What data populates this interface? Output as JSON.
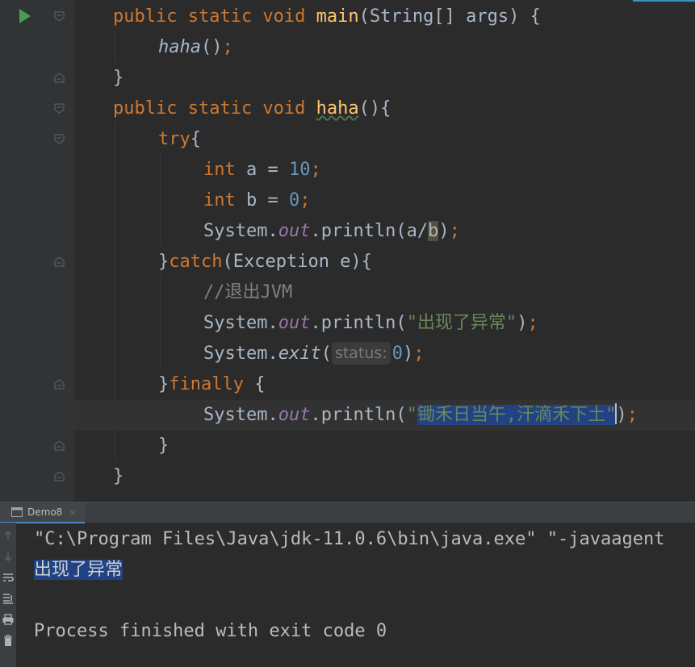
{
  "editor": {
    "lines": {
      "l1": {
        "kw1": "public static void ",
        "fn": "main",
        "rest": "(String[] args) {"
      },
      "l2": {
        "call": "haha",
        "rest": "()",
        "semi": ";"
      },
      "l3": {
        "text": "}"
      },
      "l4": {
        "kw1": "public static void ",
        "fn": "haha",
        "rest": "(){"
      },
      "l5": {
        "kw": "try",
        "rest": "{"
      },
      "l6": {
        "kw": "int ",
        "rest": "a = ",
        "num": "10",
        "semi": ";"
      },
      "l7": {
        "kw": "int ",
        "rest": "b = ",
        "num": "0",
        "semi": ";"
      },
      "l8": {
        "a": "System.",
        "fld": "out",
        "b": ".println(a/",
        "hl": "b",
        "c": ")",
        "semi": ";"
      },
      "l9": {
        "a": "}",
        "kw": "catch",
        "b": "(Exception e){"
      },
      "l10": {
        "comment": "//退出JVM"
      },
      "l11": {
        "a": "System.",
        "fld": "out",
        "b": ".println(",
        "str": "\"出现了异常\"",
        "c": ")",
        "semi": ";"
      },
      "l12": {
        "a": "System.",
        "it": "exit",
        "b": "(",
        "hint": "status:",
        "num": "0",
        "c": ")",
        "semi": ";"
      },
      "l13": {
        "a": "}",
        "kw": "finally",
        "b": " {"
      },
      "l14": {
        "a": "System.",
        "fld": "out",
        "b": ".println(",
        "q": "\"",
        "sel": "锄禾日当午,汗滴禾下土\"",
        "c": ")",
        "semi": ";"
      },
      "l15": {
        "text": "}"
      },
      "l16": {
        "text": "}"
      }
    }
  },
  "run_panel": {
    "tab_label": "Demo8",
    "tab_close": "×",
    "console": {
      "command": "\"C:\\Program Files\\Java\\jdk-11.0.6\\bin\\java.exe\" \"-javaagent",
      "output": "出现了异常",
      "finished": "Process finished with exit code 0"
    }
  },
  "icons": [
    "run-icon",
    "fold-icon",
    "up-arrow-icon",
    "down-arrow-icon",
    "soft-wrap-icon",
    "scroll-to-end-icon",
    "print-icon",
    "trash-icon",
    "console-icon"
  ],
  "colors": {
    "keyword": "#cc7832",
    "method": "#ffc66d",
    "string": "#6a8759",
    "number": "#6897bb",
    "field": "#9876aa",
    "selection": "#214283"
  }
}
